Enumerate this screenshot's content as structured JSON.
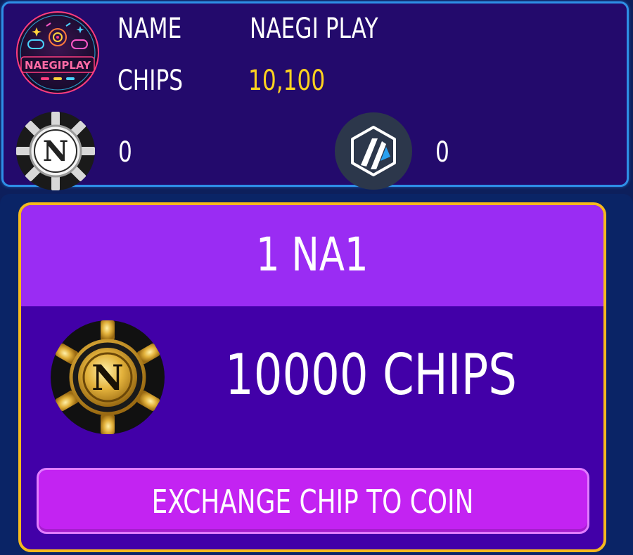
{
  "profile": {
    "logo_text": "NAEGIPLAY",
    "name_label": "NAME",
    "name_value": "NAEGI PLAY",
    "chips_label": "CHIPS",
    "chips_value": "10,100",
    "balances": [
      {
        "token_icon": "na-token-icon",
        "value": "0"
      },
      {
        "token_icon": "arbitrum-token-icon",
        "value": "0"
      }
    ]
  },
  "exchange": {
    "rate_title": "1 NA1",
    "chip_amount": "10000 CHIPS",
    "button_label": "EXCHANGE CHIP TO COIN"
  },
  "colors": {
    "profile_bg": "#230a6c",
    "profile_border": "#2e8fe6",
    "chips_value": "#ffd21f",
    "card_bg": "#4200a8",
    "card_header": "#9a2cf3",
    "card_border": "#f5b91d",
    "button_bg": "#c323f2"
  }
}
